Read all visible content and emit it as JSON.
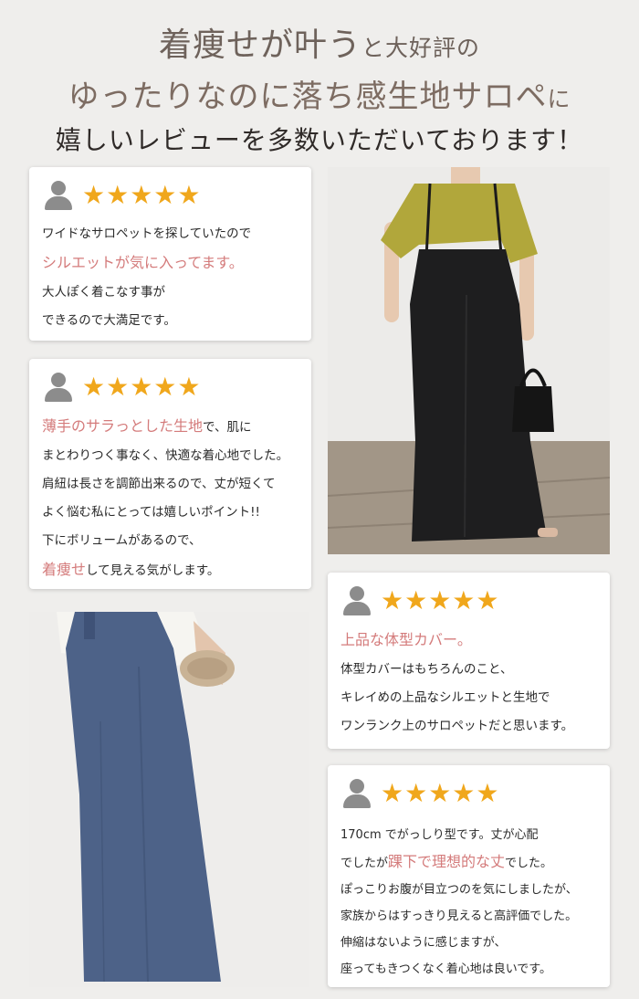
{
  "headline": {
    "line1_big": "着痩せが叶う",
    "line1_small": "と大好評の",
    "line2_big": "ゆったりなのに落ち感生地サロペ",
    "line2_small": "に",
    "line3": "嬉しいレビューを多数いただいております！"
  },
  "rating_stars": "★★★★★",
  "reviews": [
    {
      "lines": [
        {
          "a": "ワイドなサロペットを探していたので"
        },
        {
          "hl": "シルエットが気に入ってます。"
        },
        {
          "a": "大人ぽく着こなす事が"
        },
        {
          "a": "できるので大満足です。"
        }
      ]
    },
    {
      "lines": [
        {
          "hl": "薄手のサラっとした生地",
          "a": "で、肌に"
        },
        {
          "a": "まとわりつく事なく、快適な着心地でした。"
        },
        {
          "a": "肩紐は長さを調節出来るので、丈が短くて"
        },
        {
          "a": "よく悩む私にとっては嬉しいポイント!!"
        },
        {
          "a": "下にボリュームがあるので、"
        },
        {
          "hl": "着痩せ",
          "a": "して見える気がします。"
        }
      ]
    },
    {
      "lines": [
        {
          "hl": "上品な体型カバー。"
        },
        {
          "a": "体型カバーはもちろんのこと、"
        },
        {
          "a": "キレイめの上品なシルエットと生地で"
        },
        {
          "a": "ワンランク上のサロペットだと思います。"
        }
      ]
    },
    {
      "lines": [
        {
          "a": "170cm でがっしり型です。丈が心配"
        },
        {
          "a": "でしたが",
          "hl": "踝下で理想的な丈",
          "b": "でした。"
        },
        {
          "a": "ぽっこりお腹が目立つのを気にしましたが、"
        },
        {
          "a": "家族からはすっきり見えると高評価でした。"
        },
        {
          "a": "伸縮はないように感じますが、"
        },
        {
          "a": "座ってもきつくなく着心地は良いです。"
        }
      ]
    }
  ],
  "colors": {
    "star": "#f0a71c",
    "highlight": "#d47b7b",
    "navy_fabric": "#4d6288",
    "black_fabric": "#1e1e1f",
    "olive_top": "#b1a73b"
  }
}
